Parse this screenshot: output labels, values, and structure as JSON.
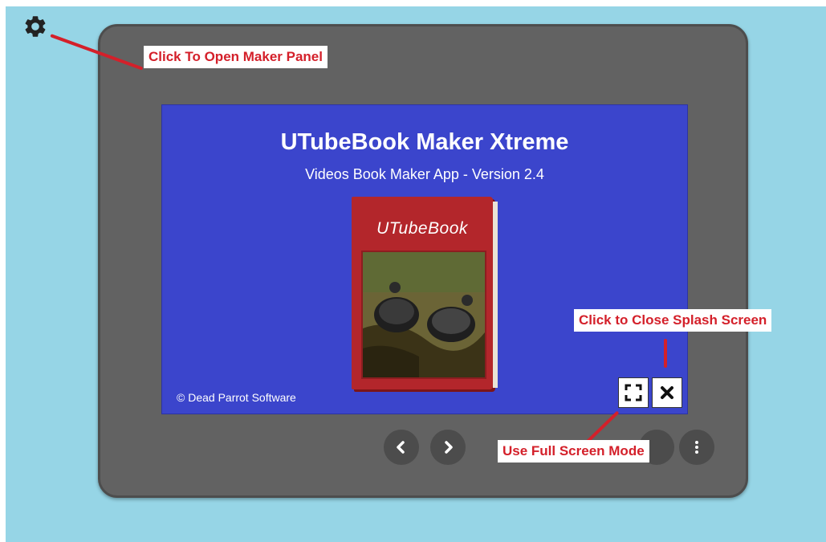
{
  "splash": {
    "title": "UTubeBook Maker Xtreme",
    "subtitle": "Videos Book Maker App - Version 2.4",
    "copyright": "© Dead Parrot Software",
    "book_title": "UTubeBook"
  },
  "annotations": {
    "maker_panel": "Click To Open Maker Panel",
    "close_splash": "Click to Close Splash Screen",
    "full_screen": "Use Full Screen Mode"
  },
  "icons": {
    "settings": "gear-icon",
    "full_screen": "fullscreen-icon",
    "close": "close-icon",
    "previous": "chevron-left-icon",
    "next": "chevron-right-icon",
    "more": "more-vertical-icon"
  },
  "colors": {
    "background": "#96d5e6",
    "device": "#626262",
    "splash": "#3b45cc",
    "book": "#b3262b",
    "annotation": "#d4202a"
  }
}
